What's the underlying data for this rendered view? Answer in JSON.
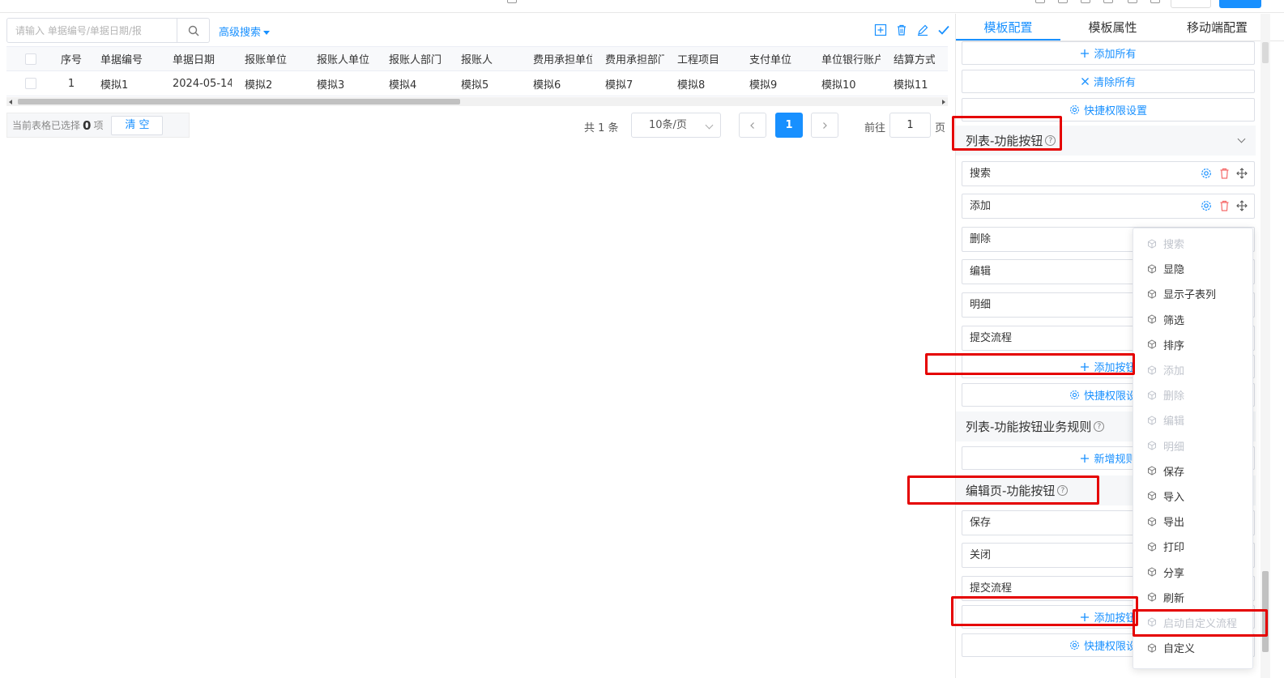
{
  "search": {
    "placeholder": "请输入 单据编号/单据日期/报",
    "advanced_label": "高级搜索"
  },
  "table": {
    "columns": [
      "序号",
      "单据编号",
      "单据日期",
      "报账单位",
      "报账人单位",
      "报账人部门",
      "报账人",
      "费用承担单位",
      "费用承担部门",
      "工程项目",
      "支付单位",
      "单位银行账户",
      "结算方式"
    ],
    "rows": [
      [
        "1",
        "模拟1",
        "2024-05-14",
        "模拟2",
        "模拟3",
        "模拟4",
        "模拟5",
        "模拟6",
        "模拟7",
        "模拟8",
        "模拟9",
        "模拟10",
        "模拟11"
      ]
    ]
  },
  "footer": {
    "selection_prefix": "当前表格已选择",
    "selection_count": "0",
    "selection_suffix": "项",
    "clear_label": "清 空",
    "total": "共 1 条",
    "page_size": "10条/页",
    "current_page": "1",
    "goto_label": "前往",
    "goto_value": "1",
    "page_unit": "页"
  },
  "right_panel": {
    "tabs": [
      "模板配置",
      "模板属性",
      "移动端配置"
    ],
    "active_tab": 0,
    "top_buttons": [
      "添加所有",
      "清除所有",
      "快捷权限设置"
    ],
    "section_list_buttons": {
      "title": "列表-功能按钮",
      "items": [
        "搜索",
        "添加",
        "删除",
        "编辑",
        "明细",
        "提交流程"
      ],
      "add_button": "添加按钮",
      "perm_button": "快捷权限设置"
    },
    "section_rules": {
      "title": "列表-功能按钮业务规则",
      "add_button": "新增规则"
    },
    "section_edit_buttons": {
      "title": "编辑页-功能按钮",
      "items": [
        "保存",
        "关闭",
        "提交流程"
      ],
      "add_button": "添加按钮",
      "perm_button": "快捷权限设置"
    }
  },
  "dropdown": {
    "items": [
      {
        "label": "搜索",
        "disabled": true
      },
      {
        "label": "显隐",
        "disabled": false
      },
      {
        "label": "显示子表列",
        "disabled": false
      },
      {
        "label": "筛选",
        "disabled": false
      },
      {
        "label": "排序",
        "disabled": false
      },
      {
        "label": "添加",
        "disabled": true
      },
      {
        "label": "删除",
        "disabled": true
      },
      {
        "label": "编辑",
        "disabled": true
      },
      {
        "label": "明细",
        "disabled": true
      },
      {
        "label": "保存",
        "disabled": false
      },
      {
        "label": "导入",
        "disabled": false
      },
      {
        "label": "导出",
        "disabled": false
      },
      {
        "label": "打印",
        "disabled": false
      },
      {
        "label": "分享",
        "disabled": false
      },
      {
        "label": "刷新",
        "disabled": false
      },
      {
        "label": "启动自定义流程",
        "disabled": true
      },
      {
        "label": "自定义",
        "disabled": false
      }
    ]
  },
  "colors": {
    "accent": "#1890ff",
    "danger": "#f56c6c",
    "annotation": "#e50000"
  }
}
